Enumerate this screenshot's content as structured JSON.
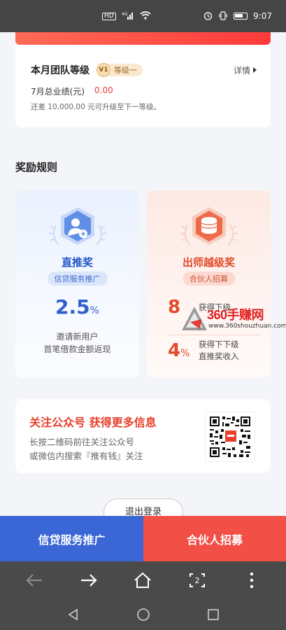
{
  "status_bar": {
    "left_icons": [
      "HD",
      "4G signal",
      "wifi"
    ],
    "time": "9:07"
  },
  "level_card": {
    "title": "本月团队等级",
    "badge_icon": "V1",
    "badge_text": "等级一",
    "detail_link": "详情",
    "performance_label": "7月总业绩(元)",
    "performance_value": "0.00",
    "upgrade_tip": "还差 10,000.00 元可升级至下一等级。"
  },
  "section_title": "奖励规则",
  "reward_cards": [
    {
      "name": "直推奖",
      "tag": "信贷服务推广",
      "rate": "2.5",
      "unit": "%",
      "desc_line1": "邀请新用户",
      "desc_line2": "首笔借款金额返现",
      "color": "#2f62c8"
    },
    {
      "name": "出师越级奖",
      "tag": "合伙人招募",
      "items": [
        {
          "rate": "8",
          "unit": "",
          "text_line1": "获得下级",
          "text_line2": ""
        },
        {
          "rate": "4",
          "unit": "%",
          "text_line1": "获得下下级",
          "text_line2": "直推奖收入"
        }
      ],
      "color": "#e24a2a"
    }
  ],
  "watermark": {
    "text": "360手赚网",
    "url": "www.360shouzhuan.com"
  },
  "follow_card": {
    "title": "关注公众号 获得更多信息",
    "desc_line1": "长按二维码前往关注公众号",
    "desc_line2": "或微信内搜索『推有钱』关注"
  },
  "logout_button": "退出登录",
  "action_bar": {
    "left": "信贷服务推广",
    "right": "合伙人招募"
  },
  "browser_bar": {
    "tab_count": "2"
  }
}
